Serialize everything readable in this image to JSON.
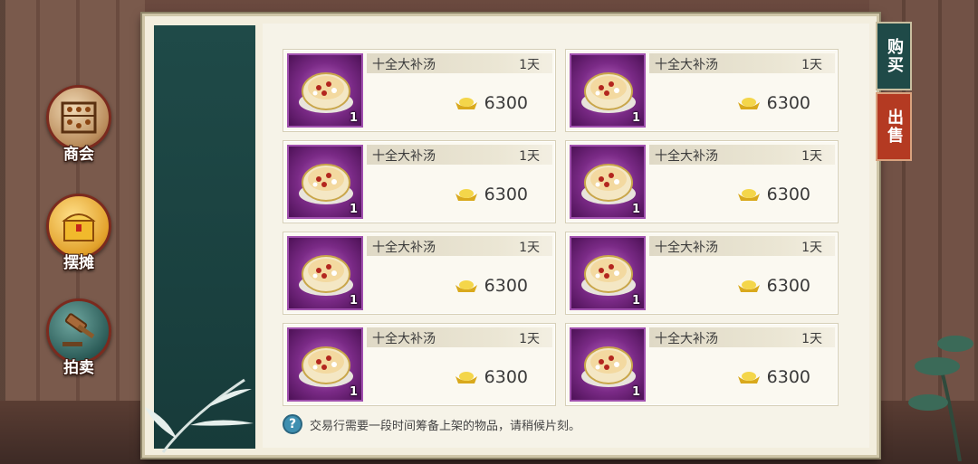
{
  "side_nav": [
    {
      "label": "商会",
      "icon": "abacus-icon"
    },
    {
      "label": "摆摊",
      "icon": "treasure-chest-icon"
    },
    {
      "label": "拍卖",
      "icon": "gavel-icon"
    }
  ],
  "tabs": {
    "buy": "购买",
    "sell": "出售"
  },
  "items": [
    {
      "name": "十全大补汤",
      "duration": "1天",
      "price": "6300",
      "quantity": "1"
    },
    {
      "name": "十全大补汤",
      "duration": "1天",
      "price": "6300",
      "quantity": "1"
    },
    {
      "name": "十全大补汤",
      "duration": "1天",
      "price": "6300",
      "quantity": "1"
    },
    {
      "name": "十全大补汤",
      "duration": "1天",
      "price": "6300",
      "quantity": "1"
    },
    {
      "name": "十全大补汤",
      "duration": "1天",
      "price": "6300",
      "quantity": "1"
    },
    {
      "name": "十全大补汤",
      "duration": "1天",
      "price": "6300",
      "quantity": "1"
    },
    {
      "name": "十全大补汤",
      "duration": "1天",
      "price": "6300",
      "quantity": "1"
    },
    {
      "name": "十全大补汤",
      "duration": "1天",
      "price": "6300",
      "quantity": "1"
    }
  ],
  "tip": {
    "icon": "question-icon",
    "text": "交易行需要一段时间筹备上架的物品，请稍候片刻。"
  },
  "colors": {
    "panel_teal": "#1f4a48",
    "sell_red": "#b43a22",
    "item_purple": "#7a2a86",
    "gold": "#e7c23a"
  }
}
